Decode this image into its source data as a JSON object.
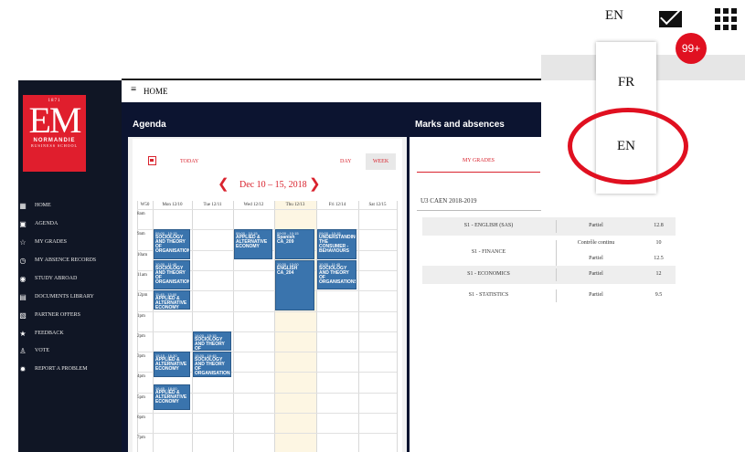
{
  "header": {
    "menu_icon": "hamburger-icon",
    "title": "HOME"
  },
  "logo": {
    "year": "1871",
    "letters": "EM",
    "name": "NORMANDIE",
    "subtitle": "BUSINESS SCHOOL"
  },
  "sidebar": {
    "items": [
      {
        "label": "HOME",
        "icon": "grid-icon"
      },
      {
        "label": "AGENDA",
        "icon": "calendar-icon"
      },
      {
        "label": "MY GRADES",
        "icon": "star-outline-icon"
      },
      {
        "label": "MY ABSENCE RECORDS",
        "icon": "clock-icon"
      },
      {
        "label": "STUDY ABROAD",
        "icon": "globe-icon"
      },
      {
        "label": "DOCUMENTS LIBRARY",
        "icon": "document-icon"
      },
      {
        "label": "PARTNER OFFERS",
        "icon": "image-icon"
      },
      {
        "label": "FEEDBACK",
        "icon": "star-icon"
      },
      {
        "label": "VOTE",
        "icon": "person-icon"
      },
      {
        "label": "REPORT A PROBLEM",
        "icon": "gear-icon"
      }
    ]
  },
  "agenda": {
    "title": "Agenda",
    "today_label": "TODAY",
    "day_label": "DAY",
    "week_label": "WEEK",
    "range": "Dec 10 – 15, 2018",
    "week_num": "W50",
    "days": [
      "Mon 12/10",
      "Tue 12/11",
      "Wed 12/12",
      "Thu 12/13",
      "Fri 12/14",
      "Sat 12/15"
    ],
    "hours": [
      "8am",
      "9am",
      "10am",
      "11am",
      "12pm",
      "1pm",
      "2pm",
      "3pm",
      "4pm",
      "5pm",
      "6pm",
      "7pm"
    ],
    "events": [
      {
        "day": 0,
        "start": 9,
        "end": 10.5,
        "time": "09:00 - 10:15",
        "title": "SOCIOLOGY AND THEORY OF ORGANISATIONS"
      },
      {
        "day": 0,
        "start": 10.5,
        "end": 12,
        "time": "10:30 - 11:45",
        "title": "SOCIOLOGY AND THEORY OF ORGANISATIONS"
      },
      {
        "day": 0,
        "start": 12,
        "end": 13,
        "time": "11:45 - 13:00",
        "title": "APPLIED & ALTERNATIVE ECONOMY"
      },
      {
        "day": 2,
        "start": 9,
        "end": 10.5,
        "time": "09:00 - 10:15",
        "title": "APPLIED & ALTERNATIVE ECONOMY"
      },
      {
        "day": 3,
        "start": 9,
        "end": 10.5,
        "time": "09:00 - 10:15",
        "title": "Spanish CA_209"
      },
      {
        "day": 3,
        "start": 10.5,
        "end": 13,
        "time": "10:30 - 13:00",
        "title": "ENGLISH CA_204"
      },
      {
        "day": 4,
        "start": 9,
        "end": 10.5,
        "time": "09:00 - 10:15",
        "title": "UNDERSTANDING THE CONSUMER - BEHAVIOURS"
      },
      {
        "day": 4,
        "start": 10.5,
        "end": 12,
        "time": "10:30 - 11:45",
        "title": "SOCIOLOGY AND THEORY OF ORGANISATIONS"
      },
      {
        "day": 1,
        "start": 14,
        "end": 15,
        "time": "14:00 - 15:15",
        "title": "SOCIOLOGY AND THEORY OF ORGANISATIONS"
      },
      {
        "day": 1,
        "start": 15,
        "end": 16.3,
        "time": "15:30 - 16:45",
        "title": "SOCIOLOGY AND THEORY OF ORGANISATIONS"
      },
      {
        "day": 0,
        "start": 15,
        "end": 16.3,
        "time": "15:15 - 16:30",
        "title": "APPLIED & ALTERNATIVE ECONOMY"
      },
      {
        "day": 0,
        "start": 16.6,
        "end": 17.9,
        "time": "16:45 - 18:00",
        "title": "APPLIED & ALTERNATIVE ECONOMY"
      }
    ]
  },
  "marks": {
    "title": "Marks and absences",
    "tab": "MY GRADES",
    "year": "U3 CAEN 2018-2019",
    "rows": [
      {
        "course": "S1 - ENGLISH (SAS)",
        "type": "Partiel",
        "grade": "12.8"
      },
      {
        "course": "S1 - FINANCE",
        "type": "Contrôle continu",
        "grade": "10",
        "type2": "Partiel",
        "grade2": "12.5"
      },
      {
        "course": "S1 - ECONOMICS",
        "type": "Partiel",
        "grade": "12"
      },
      {
        "course": "S1 - STATISTICS",
        "type": "Partiel",
        "grade": "9.5"
      }
    ]
  },
  "topbar_right": {
    "language": "EN",
    "badge": "99+"
  },
  "language_menu": {
    "options": [
      "FR",
      "EN"
    ]
  },
  "colors": {
    "brand_red": "#e01e2d",
    "navy": "#0c1430",
    "event_blue": "#3a74ad",
    "highlight_ring": "#e01020"
  }
}
